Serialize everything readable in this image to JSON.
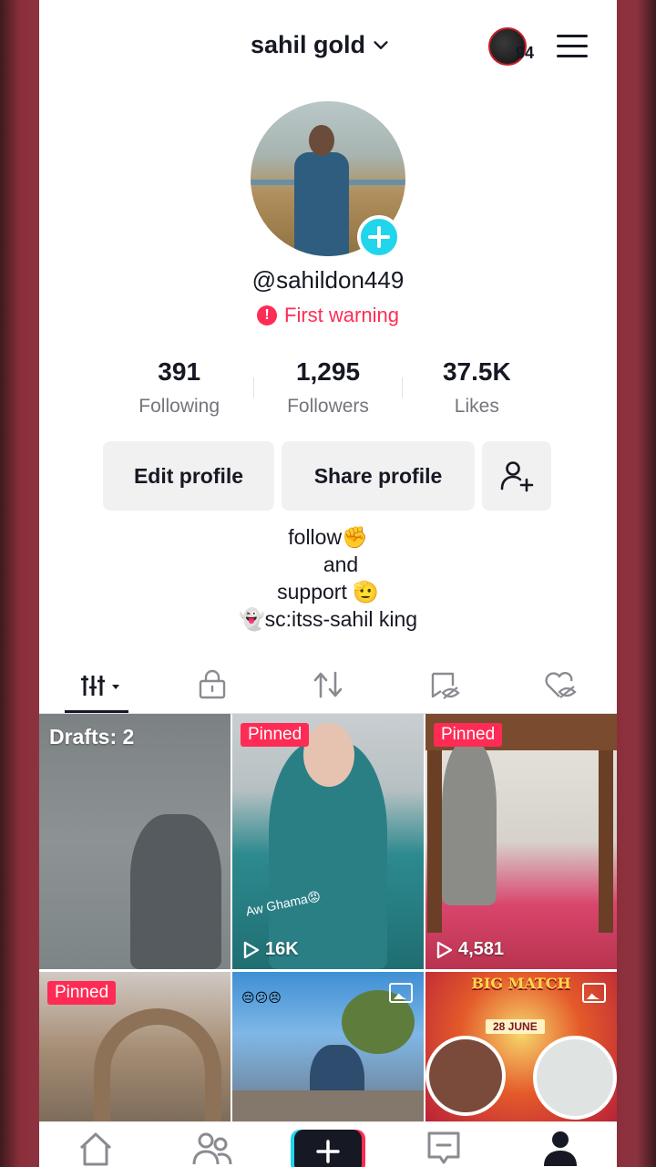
{
  "header": {
    "username": "sahil gold",
    "coins": "94",
    "icons": {
      "dropdown": "chevron-down-icon",
      "menu": "hamburger-menu-icon"
    }
  },
  "profile": {
    "handle": "@sahildon449",
    "warning": "First warning",
    "stats": [
      {
        "value": "391",
        "label": "Following"
      },
      {
        "value": "1,295",
        "label": "Followers"
      },
      {
        "value": "37.5K",
        "label": "Likes"
      }
    ],
    "buttons": {
      "edit": "Edit profile",
      "share": "Share profile"
    },
    "bio": [
      "follow✊",
      "and",
      "support 🫡",
      "👻sc:itss-sahil king"
    ]
  },
  "tabs": [
    "videos-grid-icon",
    "lock-icon",
    "repost-icon",
    "hidden-icon",
    "liked-hidden-icon"
  ],
  "grid": {
    "drafts_label": "Drafts: 2",
    "pinned_label": "Pinned",
    "items": [
      {
        "type": "drafts"
      },
      {
        "type": "video",
        "pinned": true,
        "views": "16K",
        "caption": "Aw Ghama😡"
      },
      {
        "type": "video",
        "pinned": true,
        "views": "4,581"
      },
      {
        "type": "video",
        "pinned": true
      },
      {
        "type": "photo",
        "emoji": "😔😕😣"
      },
      {
        "type": "photo",
        "title": "BIG MATCH",
        "date": "28 JUNE"
      }
    ]
  },
  "bottom_nav": [
    "home-icon",
    "friends-icon",
    "create-icon",
    "inbox-icon",
    "profile-icon"
  ]
}
